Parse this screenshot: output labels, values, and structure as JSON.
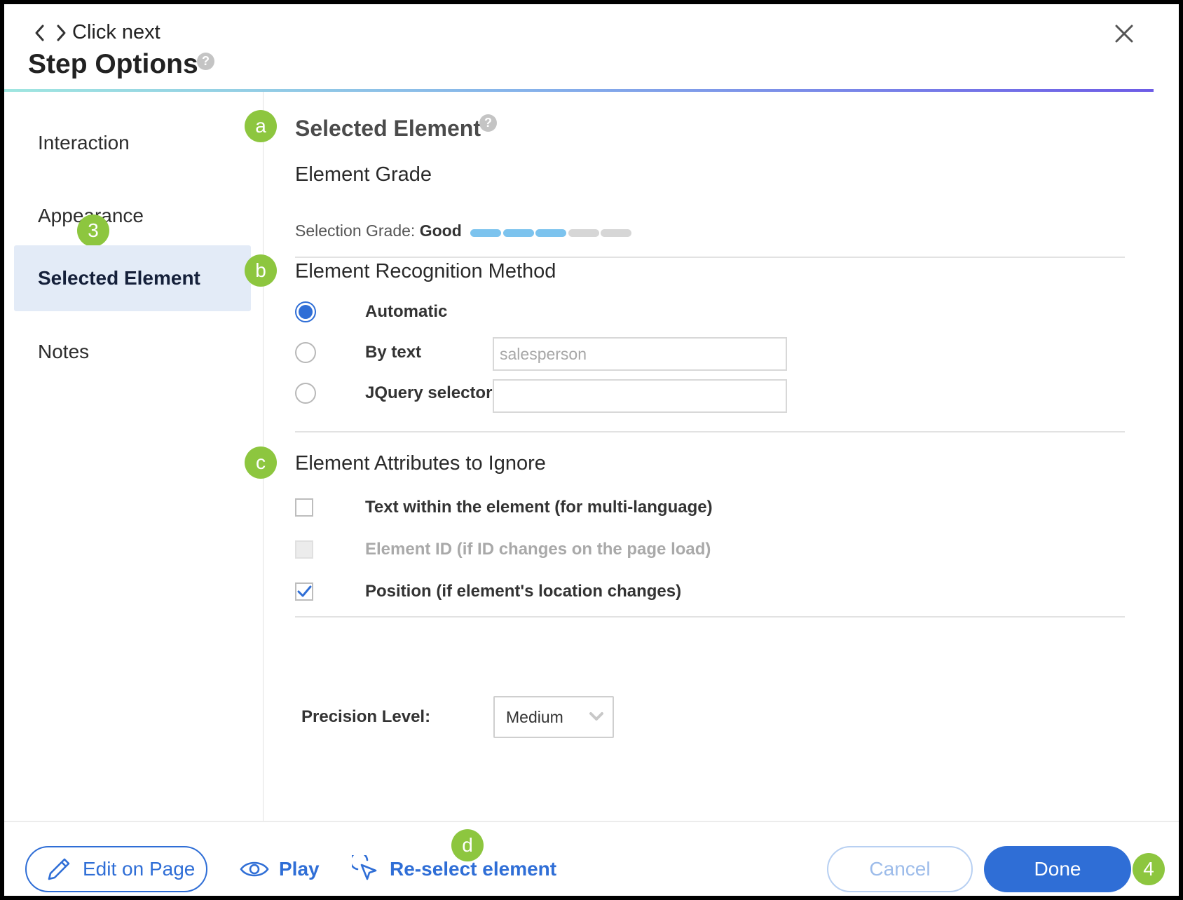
{
  "header": {
    "step_name": "Click next",
    "title": "Step Options",
    "help": "?"
  },
  "sidebar": {
    "items": [
      {
        "label": "Interaction"
      },
      {
        "label": "Appearance"
      },
      {
        "label": "Selected Element"
      },
      {
        "label": "Notes"
      }
    ],
    "active_index": 2
  },
  "badges": {
    "a": "a",
    "b": "b",
    "c": "c",
    "d": "d",
    "three": "3",
    "four": "4"
  },
  "selected_element": {
    "title": "Selected Element",
    "help": "?",
    "grade_heading": "Element Grade",
    "grade_prefix": "Selection Grade:",
    "grade_value": "Good",
    "grade_level": 3,
    "grade_max": 5,
    "grade_on_color": "#7cc3ee",
    "grade_off_color": "#d6d6d6"
  },
  "recognition": {
    "title": "Element Recognition Method",
    "options": [
      {
        "label": "Automatic",
        "checked": true
      },
      {
        "label": "By text",
        "checked": false
      },
      {
        "label": "JQuery selector",
        "checked": false
      }
    ],
    "by_text_placeholder": "salesperson",
    "jquery_value": ""
  },
  "ignore": {
    "title": "Element Attributes to Ignore",
    "options": [
      {
        "label": "Text within the element (for multi-language)",
        "checked": false,
        "disabled": false
      },
      {
        "label": "Element ID (if ID changes on the page load)",
        "checked": false,
        "disabled": true
      },
      {
        "label": "Position (if element's location changes)",
        "checked": true,
        "disabled": false
      }
    ]
  },
  "precision": {
    "label": "Precision Level:",
    "selected": "Medium"
  },
  "footer": {
    "edit_label": "Edit on Page",
    "play_label": "Play",
    "reselect_label": "Re-select element",
    "cancel_label": "Cancel",
    "done_label": "Done"
  },
  "colors": {
    "accent": "#2f6ed6",
    "badge": "#8dc63f",
    "active_nav_bg": "#e3ebf7"
  }
}
